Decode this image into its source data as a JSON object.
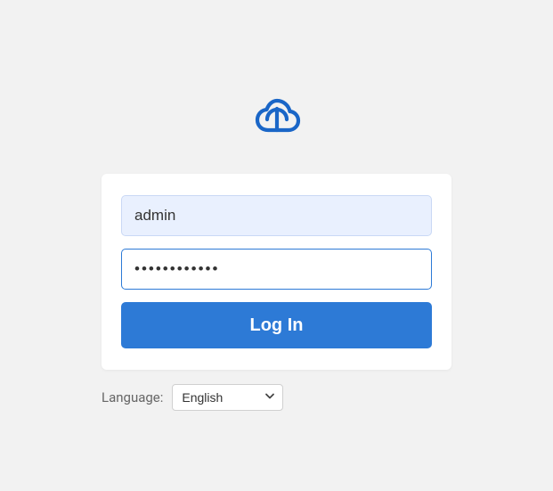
{
  "logo": {
    "name": "cloud-sync-icon",
    "color": "#1a66c7"
  },
  "form": {
    "username_value": "admin",
    "username_placeholder": "",
    "password_value": "••••••••••••",
    "password_placeholder": "",
    "login_label": "Log In"
  },
  "language": {
    "label": "Language:",
    "selected": "English",
    "options": [
      "English"
    ]
  }
}
